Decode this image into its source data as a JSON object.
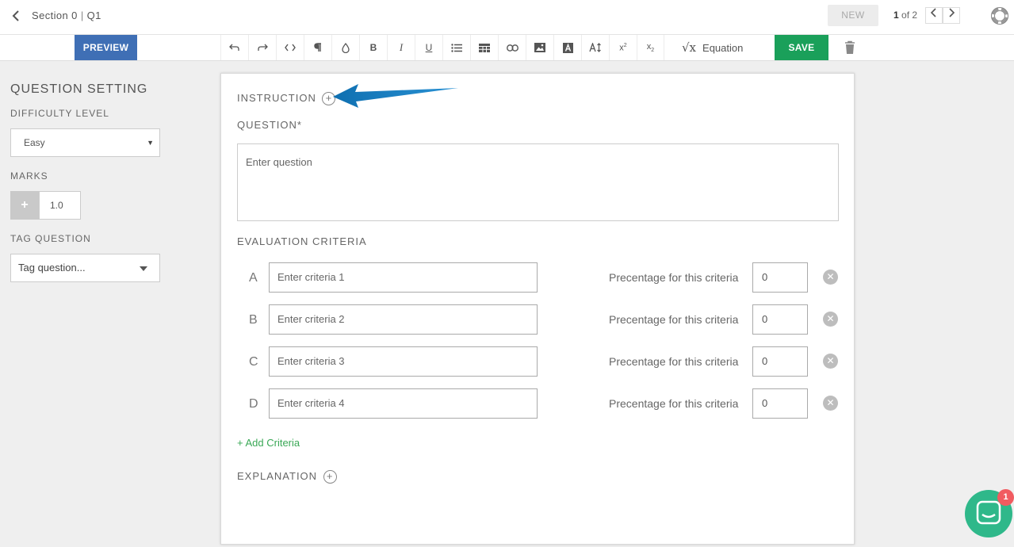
{
  "header": {
    "section": "Section 0",
    "separator": "|",
    "question": "Q1",
    "new_label": "NEW",
    "pager_current": "1",
    "pager_of": " of 2"
  },
  "toolbar": {
    "preview_label": "PREVIEW",
    "equation_label": "Equation",
    "save_label": "SAVE",
    "tools": [
      "undo-icon",
      "redo-icon",
      "code-icon",
      "paragraph-icon",
      "color-drop-icon",
      "bold-icon",
      "italic-icon",
      "underline-icon",
      "list-icon",
      "table-icon",
      "link-icon",
      "image-icon",
      "text-color-icon",
      "font-size-icon",
      "superscript-icon",
      "subscript-icon"
    ]
  },
  "settings": {
    "title": "QUESTION SETTING",
    "difficulty_label": "DIFFICULTY LEVEL",
    "difficulty_value": "Easy",
    "marks_label": "MARKS",
    "marks_value": "1.0",
    "tag_label": "TAG QUESTION",
    "tag_placeholder": "Tag question..."
  },
  "editor": {
    "instruction_label": "INSTRUCTION",
    "question_label": "QUESTION*",
    "question_placeholder": "Enter question",
    "criteria_label": "EVALUATION CRITERIA",
    "percentage_label": "Precentage for this criteria",
    "criteria": [
      {
        "letter": "A",
        "placeholder": "Enter criteria 1",
        "percent": "0"
      },
      {
        "letter": "B",
        "placeholder": "Enter criteria 2",
        "percent": "0"
      },
      {
        "letter": "C",
        "placeholder": "Enter criteria 3",
        "percent": "0"
      },
      {
        "letter": "D",
        "placeholder": "Enter criteria 4",
        "percent": "0"
      }
    ],
    "add_criteria_label": "+ Add Criteria",
    "explanation_label": "EXPLANATION"
  },
  "chat": {
    "badge_count": "1"
  },
  "colors": {
    "preview": "#3f6fb5",
    "save": "#1aa05a",
    "add_criteria": "#3aa856",
    "chat": "#2fb88a",
    "badge": "#f15b60",
    "arrow": "#1a7bbf"
  }
}
